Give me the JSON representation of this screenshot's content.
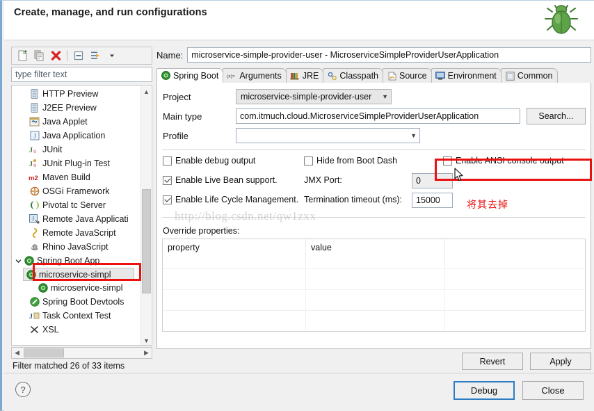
{
  "header": {
    "title": "Create, manage, and run configurations",
    "icon": "bug-icon"
  },
  "left_panel": {
    "toolbar": [
      {
        "name": "new-configuration-icon",
        "label": "New"
      },
      {
        "name": "duplicate-icon",
        "label": "Duplicate"
      },
      {
        "name": "delete-icon",
        "label": "Delete"
      },
      {
        "name": "collapse-all-icon",
        "label": "Collapse All"
      },
      {
        "name": "filter-icon",
        "label": "Filter"
      },
      {
        "name": "chevron-down-icon",
        "label": "Menu"
      }
    ],
    "filter": {
      "placeholder": "type filter text",
      "value": ""
    },
    "tree": [
      {
        "label": "HTTP Preview",
        "icon": "server-icon",
        "indent": 1,
        "selected": false,
        "twisty": ""
      },
      {
        "label": "J2EE Preview",
        "icon": "server-icon",
        "indent": 1,
        "selected": false,
        "twisty": ""
      },
      {
        "label": "Java Applet",
        "icon": "java-applet-icon",
        "indent": 1,
        "selected": false,
        "twisty": ""
      },
      {
        "label": "Java Application",
        "icon": "java-application-icon",
        "indent": 1,
        "selected": false,
        "twisty": ""
      },
      {
        "label": "JUnit",
        "icon": "junit-icon",
        "indent": 1,
        "selected": false,
        "twisty": ""
      },
      {
        "label": "JUnit Plug-in Test",
        "icon": "junit-plugin-icon",
        "indent": 1,
        "selected": false,
        "twisty": ""
      },
      {
        "label": "Maven Build",
        "icon": "maven-icon",
        "indent": 1,
        "selected": false,
        "twisty": ""
      },
      {
        "label": "OSGi Framework",
        "icon": "osgi-icon",
        "indent": 1,
        "selected": false,
        "twisty": ""
      },
      {
        "label": "Pivotal tc Server",
        "icon": "pivotal-icon",
        "indent": 1,
        "selected": false,
        "twisty": ""
      },
      {
        "label": "Remote Java Applicati",
        "icon": "remote-java-icon",
        "indent": 1,
        "selected": false,
        "twisty": ""
      },
      {
        "label": "Remote JavaScript",
        "icon": "remote-js-icon",
        "indent": 1,
        "selected": false,
        "twisty": ""
      },
      {
        "label": "Rhino JavaScript",
        "icon": "rhino-icon",
        "indent": 1,
        "selected": false,
        "twisty": ""
      },
      {
        "label": "Spring Boot App",
        "icon": "spring-boot-icon",
        "indent": 0,
        "selected": false,
        "twisty": "expanded"
      },
      {
        "label": "microservice-simpl",
        "icon": "spring-boot-icon",
        "indent": 2,
        "selected": true,
        "twisty": ""
      },
      {
        "label": "microservice-simpl",
        "icon": "spring-boot-icon",
        "indent": 2,
        "selected": false,
        "twisty": ""
      },
      {
        "label": "Spring Boot Devtools",
        "icon": "devtools-icon",
        "indent": 1,
        "selected": false,
        "twisty": ""
      },
      {
        "label": "Task Context Test",
        "icon": "task-context-icon",
        "indent": 1,
        "selected": false,
        "twisty": ""
      },
      {
        "label": "XSL",
        "icon": "xsl-icon",
        "indent": 1,
        "selected": false,
        "twisty": ""
      }
    ],
    "status": "Filter matched 26 of 33 items"
  },
  "right_panel": {
    "name_label": "Name:",
    "name_value": "microservice-simple-provider-user - MicroserviceSimpleProviderUserApplication",
    "tabs": [
      {
        "label": "Spring Boot",
        "icon": "spring-boot-icon",
        "active": true
      },
      {
        "label": "Arguments",
        "icon": "arguments-icon",
        "active": false
      },
      {
        "label": "JRE",
        "icon": "jre-icon",
        "active": false
      },
      {
        "label": "Classpath",
        "icon": "classpath-icon",
        "active": false
      },
      {
        "label": "Source",
        "icon": "source-icon",
        "active": false
      },
      {
        "label": "Environment",
        "icon": "environment-icon",
        "active": false
      },
      {
        "label": "Common",
        "icon": "common-icon",
        "active": false
      }
    ],
    "form": {
      "project_label": "Project",
      "project_value": "microservice-simple-provider-user",
      "main_type_label": "Main type",
      "main_type_value": "com.itmuch.cloud.MicroserviceSimpleProviderUserApplication",
      "search_button": "Search...",
      "profile_label": "Profile",
      "profile_value": ""
    },
    "checkboxes": {
      "enable_debug_output": {
        "label": "Enable debug output",
        "checked": false
      },
      "hide_from_boot_dash": {
        "label": "Hide from Boot Dash",
        "checked": false
      },
      "enable_ansi_console_output": {
        "label": "Enable ANSI console output",
        "checked": false
      },
      "enable_live_bean_support": {
        "label": "Enable Live Bean support.",
        "checked": true
      },
      "enable_life_cycle_management": {
        "label": "Enable Life Cycle Management.",
        "checked": true
      }
    },
    "fields": {
      "jmx_port_label": "JMX Port:",
      "jmx_port_value": "0",
      "termination_timeout_label": "Termination timeout (ms):",
      "termination_timeout_value": "15000"
    },
    "override_properties": {
      "section_label": "Override properties:",
      "columns": [
        "property",
        "value",
        ""
      ],
      "rows": []
    },
    "buttons": {
      "revert": "Revert",
      "apply": "Apply"
    }
  },
  "footer": {
    "help_glyph": "?",
    "debug_button": "Debug",
    "close_button": "Close"
  },
  "annotations": {
    "note_text": "将其去掉",
    "note_color": "#e8110f",
    "highlight_color": "#e8110f",
    "watermark": "http://blog.csdn.net/qw1zxx"
  }
}
